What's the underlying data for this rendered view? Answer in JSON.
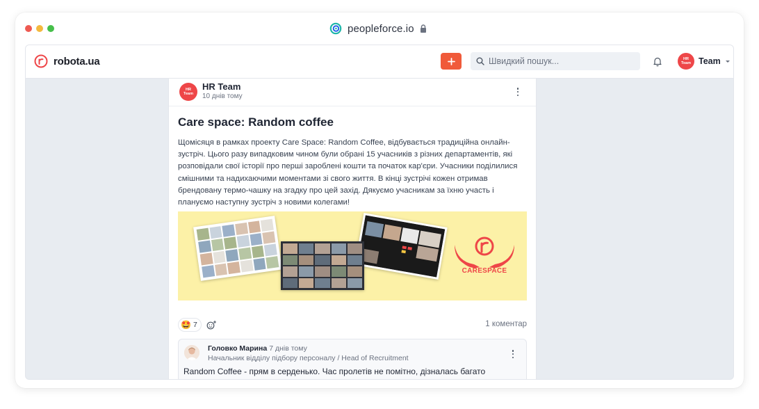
{
  "browser": {
    "url": "peopleforce.io"
  },
  "topnav": {
    "logo_text": "robota.ua",
    "add_button_label": "+",
    "search_placeholder": "Швидкий пошук...",
    "user_name": "Team",
    "avatar_line1": "HR",
    "avatar_line2": "Team"
  },
  "post": {
    "author": "HR Team",
    "time": "10 днів тому",
    "avatar_line1": "HR",
    "avatar_line2": "Team",
    "title": "Care space: Random coffee",
    "body": "Щомісяця в рамках проекту Care Space: Random Coffee, відбувається традиційна онлайн-зустріч. Цього разу випадковим чином були обрані 15 учасників з різних департаментів, які розповідали свої історії про перші зароблені кошти та початок кар'єри. Учасники поділилися смішними та надихаючими моментами зі свого життя. В кінці зустрічі кожен отримав брендовану термо-чашку на згадку про цей захід. Дякуємо учасникам за їхню участь і плануємо наступну зустріч з новими колегами!",
    "banner_brand": "CARESPACE",
    "reaction_emoji": "🤩",
    "reaction_count": "7",
    "comment_count_label": "1 коментар"
  },
  "comment": {
    "author": "Головко Марина",
    "time": "7 днів тому",
    "role": "Начальник відділу підбору персоналу / Head of Recruitment",
    "text": "Random Coffee - прям в серденько. Час пролетів не помітно, дізналась багато"
  },
  "colors": {
    "accent": "#f05a3a",
    "brand_red": "#ee4648",
    "banner_bg": "#fcf1a7",
    "page_bg": "#e8ecf1"
  }
}
